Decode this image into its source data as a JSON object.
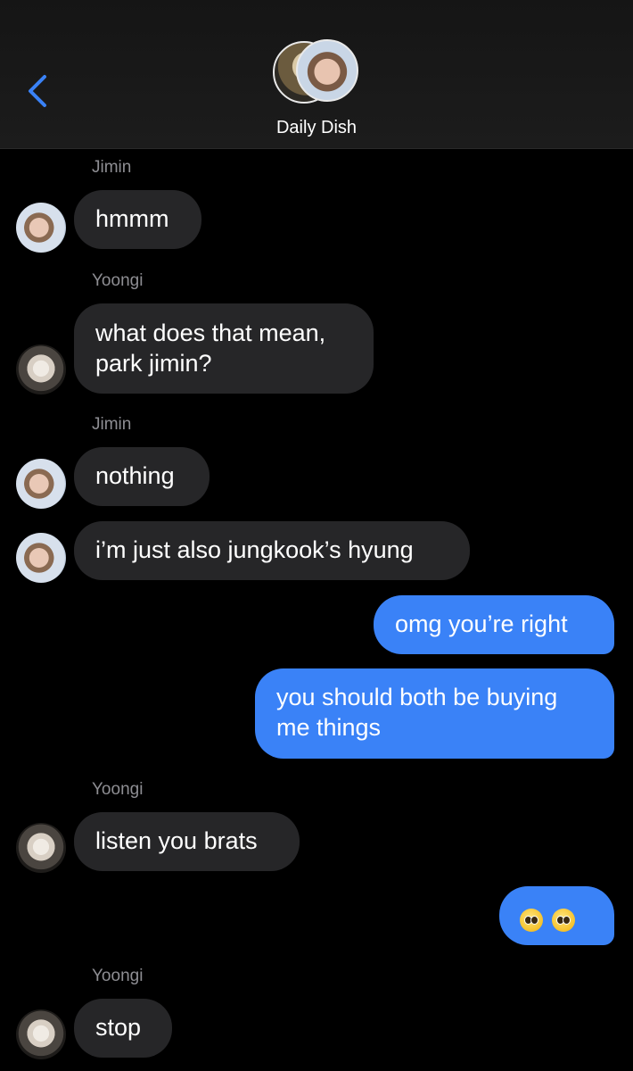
{
  "header": {
    "group_name": "Daily Dish",
    "accent_color": "#3a82f7",
    "back_icon": "chevron-left-icon"
  },
  "messages": [
    {
      "sender": "Jimin",
      "text": "hmmm",
      "direction": "incoming"
    },
    {
      "sender": "Yoongi",
      "text": "what does that mean,\npark jimin?",
      "direction": "incoming"
    },
    {
      "sender": "Jimin",
      "text": "nothing",
      "direction": "incoming"
    },
    {
      "sender": "",
      "text": "i’m just also jungkook’s hyung",
      "direction": "incoming"
    },
    {
      "sender": "",
      "text": "omg you’re right",
      "direction": "outgoing"
    },
    {
      "sender": "",
      "text": "you should both be buying\nme things",
      "direction": "outgoing"
    },
    {
      "sender": "Yoongi",
      "text": "listen you brats",
      "direction": "incoming"
    },
    {
      "sender": "",
      "text": "🥺🥺",
      "direction": "outgoing",
      "icon": "pleading-face-emoji"
    },
    {
      "sender": "Yoongi",
      "text": "stop",
      "direction": "incoming"
    }
  ],
  "colors": {
    "incoming_bubble": "#262628",
    "outgoing_bubble": "#3a82f7",
    "sender_label": "#8e8e93"
  }
}
